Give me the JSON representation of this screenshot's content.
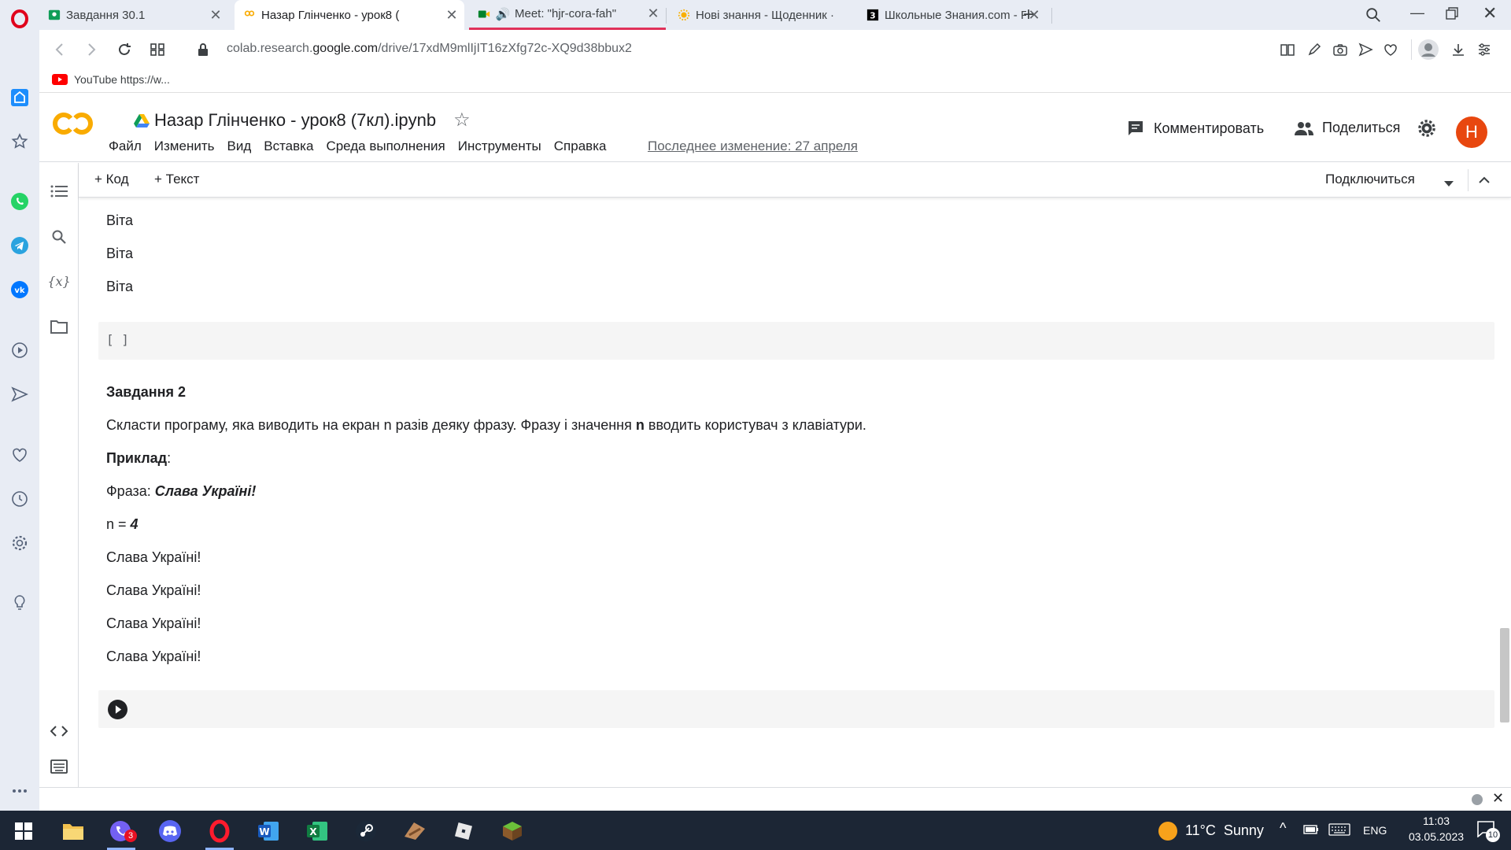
{
  "browser": {
    "tabs": [
      {
        "title": "Завдання 30.1",
        "active": false
      },
      {
        "title": "Назар Глінченко - урок8 (",
        "active": true
      },
      {
        "title": "Meet: \"hjr-cora-fah\"",
        "active": false
      },
      {
        "title": "Нові знання - Щоденник ·",
        "active": false
      },
      {
        "title": "Школьные Знания.com - F",
        "active": false
      }
    ],
    "url_prefix": "colab.research.",
    "url_domain": "google.com",
    "url_path": "/drive/17xdM9mlIjIT16zXfg72c-XQ9d38bbux2",
    "bookmark_label": "YouTube https://w..."
  },
  "colab": {
    "logo_text": "CO",
    "doc_title": "Назар Глінченко - урок8 (7кл).ipynb",
    "menu": [
      "Файл",
      "Изменить",
      "Вид",
      "Вставка",
      "Среда выполнения",
      "Инструменты",
      "Справка"
    ],
    "last_change": "Последнее изменение: 27 апреля",
    "comment_label": "Комментировать",
    "share_label": "Поделиться",
    "avatar_letter": "Н",
    "add_code_label": "Код",
    "add_text_label": "Текст",
    "connect_label": "Подключиться"
  },
  "notebook": {
    "output_lines": [
      "Віта",
      "Віта",
      "Віта"
    ],
    "empty_cell_brackets": "[ ]",
    "task": {
      "heading": "Завдання 2",
      "desc_before": "Скласти програму, яка виводить на екран n разів деяку фразу. Фразу і значення ",
      "desc_bold": "n",
      "desc_after": " вводить користувач з клавіатури.",
      "example_label": "Приклад",
      "example_colon": ":",
      "phrase_label": "Фраза: ",
      "phrase_value": "Слава Україні!",
      "n_label": "n = ",
      "n_value": "4",
      "repeats": [
        "Слава Україні!",
        "Слава Україні!",
        "Слава Україні!",
        "Слава Україні!"
      ]
    }
  },
  "taskbar": {
    "badge_count": "3",
    "weather": "11°C  Sunny",
    "lang": "ENG",
    "time": "11:03",
    "date": "03.05.2023",
    "notifications": "10"
  },
  "colors": {
    "accent_orange": "#f9ab00",
    "avatar": "#e8470f",
    "taskbar": "#1c2635"
  }
}
